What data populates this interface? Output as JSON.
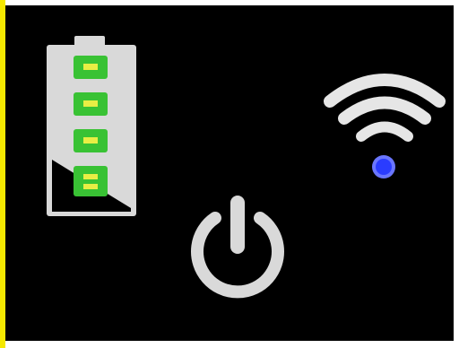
{
  "status_panel": {
    "battery": {
      "icon": "battery-icon",
      "level_bars": 4,
      "max_bars": 4,
      "bar_color": "#39c234",
      "bar_highlight": "#e8ee44",
      "body_color": "#d9d9d9"
    },
    "wifi": {
      "icon": "wifi-icon",
      "arc_color": "#e6e6e6",
      "led_icon": "status-led-icon",
      "led_color": "#2a3cff"
    },
    "power": {
      "icon": "power-icon",
      "color": "#d9d9d9"
    },
    "colors": {
      "background": "#000000",
      "left_edge": "#f5e800"
    }
  }
}
